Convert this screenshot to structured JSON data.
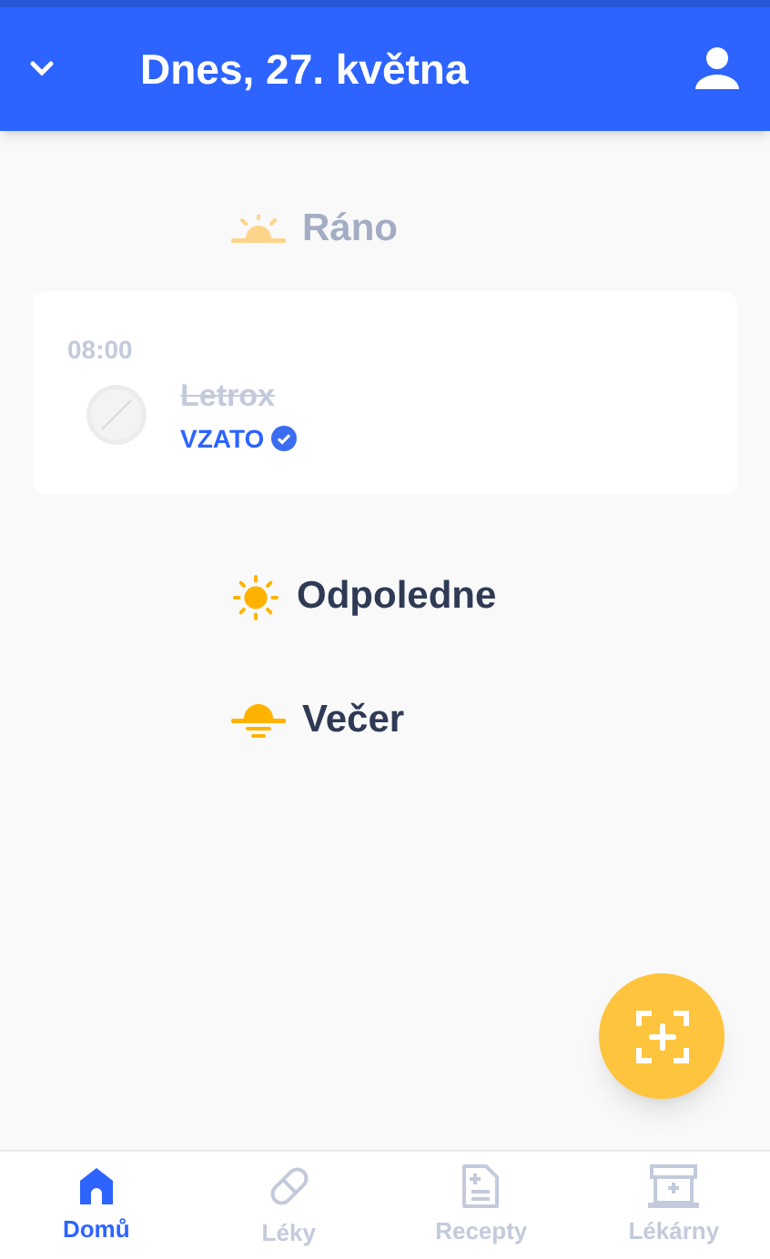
{
  "header": {
    "title": "Dnes, 27. května"
  },
  "sections": [
    {
      "kind": "morning",
      "label": "Ráno",
      "past": true,
      "doses": [
        {
          "time": "08:00",
          "name": "Letrox",
          "taken": true,
          "status": "VZATO"
        }
      ]
    },
    {
      "kind": "afternoon",
      "label": "Odpoledne",
      "past": false
    },
    {
      "kind": "evening",
      "label": "Večer",
      "past": false
    }
  ],
  "nav": [
    {
      "kind": "home",
      "label": "Domů",
      "selected": true
    },
    {
      "kind": "pill",
      "label": "Léky",
      "selected": false
    },
    {
      "kind": "doc",
      "label": "Recepty",
      "selected": false
    },
    {
      "kind": "store",
      "label": "Lékárny",
      "selected": false
    }
  ]
}
